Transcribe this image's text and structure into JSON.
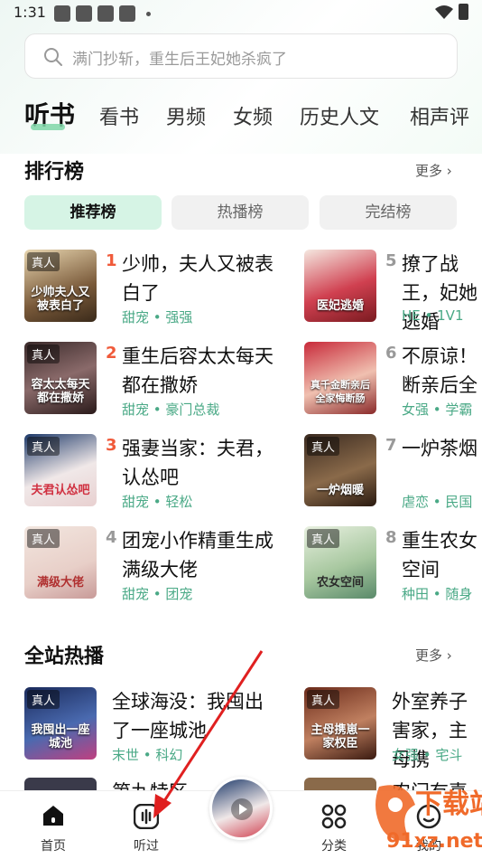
{
  "status": {
    "time": "1:31"
  },
  "search": {
    "placeholder": "满门抄斩，重生后王妃她杀疯了"
  },
  "tabs": [
    "听书",
    "看书",
    "男频",
    "女频",
    "历史人文",
    "相声评"
  ],
  "ranking": {
    "title": "排行榜",
    "more": "更多",
    "subtabs": [
      "推荐榜",
      "热播榜",
      "完结榜"
    ],
    "badge": "真人",
    "items": [
      {
        "rank": "1",
        "title": "少帅，夫人又被表白了",
        "tags": "甜宠 • 强强",
        "cover_text": "少帅夫人又被表白了"
      },
      {
        "rank": "2",
        "title": "重生后容太太每天都在撒娇",
        "tags": "甜宠 • 豪门总裁",
        "cover_text": "容太太每天都在撒娇"
      },
      {
        "rank": "3",
        "title": "强妻当家：夫君，认怂吧",
        "tags": "甜宠 • 轻松",
        "cover_text": "夫君认怂吧"
      },
      {
        "rank": "4",
        "title": "团宠小作精重生成满级大佬",
        "tags": "甜宠 • 团宠",
        "cover_text": "满级大佬"
      },
      {
        "rank": "5",
        "title": "撩了战王，妃她逃婚",
        "tags": "HE • 1V1",
        "cover_text": "医妃逃婚"
      },
      {
        "rank": "6",
        "title": "不原谅！断亲后全",
        "tags": "女强 • 学霸",
        "cover_text": "真千金断亲后全家悔断肠"
      },
      {
        "rank": "7",
        "title": "一炉茶烟",
        "tags": "虐恋 • 民国",
        "cover_text": "一炉烟暖"
      },
      {
        "rank": "8",
        "title": "重生农女空间",
        "tags": "种田 • 随身",
        "cover_text": "农女空间"
      }
    ]
  },
  "hot": {
    "title": "全站热播",
    "more": "更多",
    "badge": "真人",
    "items": [
      {
        "title": "全球海没：我囤出了一座城池",
        "tags": "末世 • 科幻",
        "cover_text": "我囤出一座城池"
      },
      {
        "title": "外室养子害家，主母携",
        "tags": "女强 • 宅斗",
        "cover_text": "主母携崽一家权臣"
      },
      {
        "title": "第九特区",
        "tags": "",
        "cover_text": ""
      },
      {
        "title": "农门有喜",
        "tags": "",
        "cover_text": ""
      }
    ]
  },
  "nav": {
    "home": "首页",
    "listened": "听过",
    "category": "分类",
    "mine": "我的"
  },
  "watermark": {
    "brand": "下载站",
    "url": "91xz.net"
  }
}
